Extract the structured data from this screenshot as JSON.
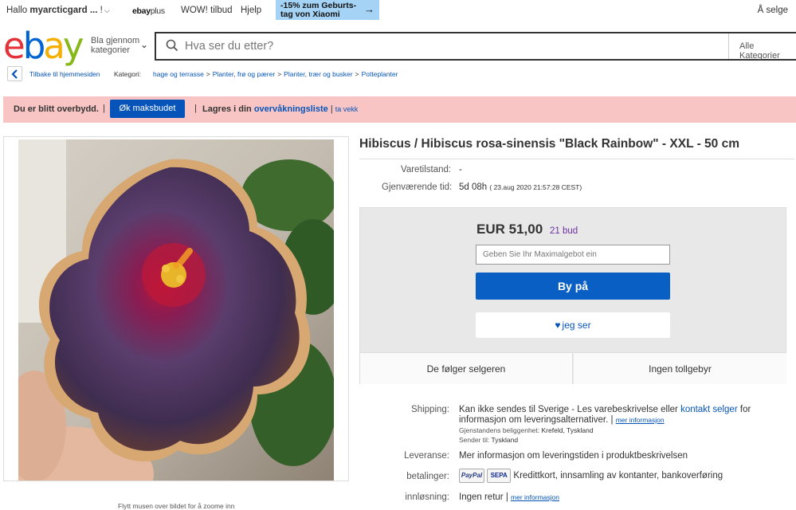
{
  "topbar": {
    "greeting_prefix": "Hallo",
    "username": "myarcticgard ...",
    "greeting_suffix": "!",
    "ebay_plus_brand": "ebay",
    "ebay_plus_label": "plus",
    "wow": "WOW! tilbud",
    "help": "Hjelp",
    "promo_line1": "-15% zum Geburts-",
    "promo_line2": "tag von Xiaomi",
    "sell": "Å selge"
  },
  "header": {
    "logo": [
      "e",
      "b",
      "a",
      "y"
    ],
    "category_button": "Bla gjennom kategorier",
    "search_placeholder": "Hva ser du etter?",
    "all_categories": "Alle Kategorier"
  },
  "breadcrumb": {
    "back": "Tilbake til hjemmesiden",
    "category_label": "Kategori:",
    "items": [
      "hage og terrasse",
      "Planter, frø og pærer",
      "Planter, trær og busker",
      "Potteplanter"
    ]
  },
  "alert": {
    "message": "Du er blitt overbydd.",
    "pipe": "|",
    "raise_button": "Øk maksbudet",
    "saved_prefix": "Lagres i din",
    "watchlist_link": "overvåkningsliste",
    "bar": "|",
    "away_link": "ta vekk"
  },
  "image": {
    "zoom_hint": "Flytt musen over bildet for å zoome inn"
  },
  "item": {
    "title": "Hibiscus / Hibiscus rosa-sinensis \"Black Rainbow\" - XXL - 50 cm",
    "condition_label": "Varetilstand:",
    "condition_value": "-",
    "time_left_label": "Gjenværende tid:",
    "time_left_value": "5d 08h",
    "end_date": "( 23.aug 2020  21:57:28 CEST)"
  },
  "bid": {
    "price": "EUR 51,00",
    "bids": "21  bud",
    "input_placeholder": "Geben Sie Ihr Maximalgebot ein",
    "bid_button": "By på",
    "watch_button": "jeg ser",
    "follow_seller": "De følger selgeren",
    "no_customs": "Ingen tollgebyr"
  },
  "shipping": {
    "label": "Shipping:",
    "text1": "Kan ikke sendes til Sverige - Les varebeskrivelse eller",
    "contact_link": "kontakt selger",
    "text2": "for",
    "text3": "informasjon om leveringsalternativer.",
    "bar": "|",
    "more_link": "mer informasjon",
    "location_label": "Gjenstandens beliggenhet:",
    "location_value": "Krefeld, Tyskland",
    "ships_from_label": "Sender til:",
    "ships_from_value": "Tyskland"
  },
  "delivery": {
    "label": "Leveranse:",
    "value": "Mer informasjon om leveringstiden i produktbeskrivelsen"
  },
  "payment": {
    "label": "betalinger:",
    "paypal": "PayPal",
    "sepa": "SEPA",
    "value": "Kredittkort, innsamling av kontanter, bankoverføring"
  },
  "returns": {
    "label": "innløsning:",
    "value": "Ingen retur",
    "bar": "|",
    "more_link": "mer informasjon"
  },
  "colors": {
    "alert_bg": "#f8c5c4",
    "primary_blue": "#0654ba",
    "bid_button": "#0a5fc5",
    "bid_count": "#6b2fa4",
    "promo_bg": "#a5d3f5"
  }
}
